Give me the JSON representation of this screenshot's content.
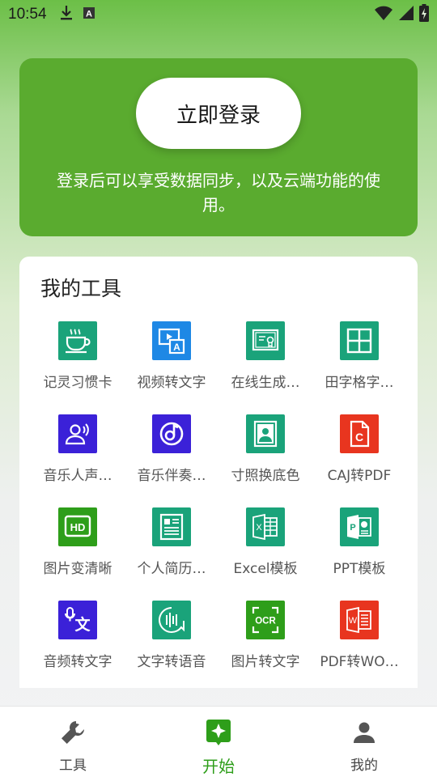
{
  "status_bar": {
    "time": "10:54",
    "icons": [
      "download-icon",
      "a-notification-icon",
      "wifi-icon",
      "signal-icon",
      "battery-charging-icon"
    ]
  },
  "login": {
    "button_label": "立即登录",
    "description": "登录后可以享受数据同步，以及云端功能的使用。"
  },
  "tools": {
    "title": "我的工具",
    "items": [
      {
        "label": "记灵习惯卡",
        "icon": "coffee-cup-icon",
        "color": "#1aa37a"
      },
      {
        "label": "视频转文字",
        "icon": "video-to-text-icon",
        "color": "#1e88e5"
      },
      {
        "label": "在线生成…",
        "icon": "certificate-icon",
        "color": "#1aa37a"
      },
      {
        "label": "田字格字…",
        "icon": "grid-icon",
        "color": "#1aa37a"
      },
      {
        "label": "音乐人声…",
        "icon": "voice-person-icon",
        "color": "#3b21d8"
      },
      {
        "label": "音乐伴奏…",
        "icon": "music-disc-icon",
        "color": "#3b21d8"
      },
      {
        "label": "寸照换底色",
        "icon": "id-photo-icon",
        "color": "#1aa37a"
      },
      {
        "label": "CAJ转PDF",
        "icon": "caj-file-icon",
        "color": "#e8351f"
      },
      {
        "label": "图片变清晰",
        "icon": "hd-icon",
        "color": "#2e9e1a"
      },
      {
        "label": "个人简历…",
        "icon": "resume-icon",
        "color": "#1aa37a"
      },
      {
        "label": "Excel模板",
        "icon": "excel-icon",
        "color": "#1aa37a"
      },
      {
        "label": "PPT模板",
        "icon": "ppt-icon",
        "color": "#1aa37a"
      },
      {
        "label": "音频转文字",
        "icon": "audio-to-text-icon",
        "color": "#3b21d8"
      },
      {
        "label": "文字转语音",
        "icon": "text-to-speech-icon",
        "color": "#1aa37a"
      },
      {
        "label": "图片转文字",
        "icon": "ocr-icon",
        "color": "#2e9e1a"
      },
      {
        "label": "PDF转WO…",
        "icon": "word-icon",
        "color": "#e8351f"
      }
    ]
  },
  "bottom_nav": {
    "items": [
      {
        "label": "工具",
        "icon": "wrench-icon"
      },
      {
        "label": "开始",
        "icon": "sparkle-icon",
        "active": true
      },
      {
        "label": "我的",
        "icon": "person-icon"
      }
    ]
  }
}
